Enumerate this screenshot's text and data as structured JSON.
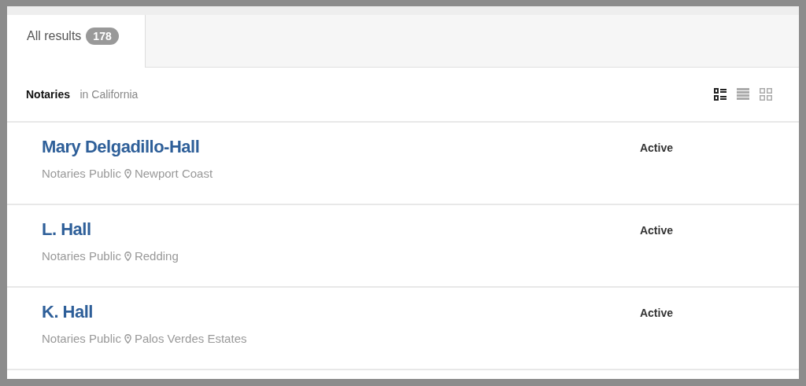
{
  "tabs": [
    {
      "label": "All results",
      "count": "178",
      "selected": true
    }
  ],
  "header": {
    "category": "Notaries",
    "location": "in California"
  },
  "view_options": [
    {
      "kind": "detail",
      "selected": true
    },
    {
      "kind": "list",
      "selected": false
    },
    {
      "kind": "grid",
      "selected": false
    }
  ],
  "results": [
    {
      "name": "Mary Delgadillo-Hall",
      "category": "Notaries Public",
      "place": "Newport Coast",
      "status": "Active"
    },
    {
      "name": "L. Hall",
      "category": "Notaries Public",
      "place": "Redding",
      "status": "Active"
    },
    {
      "name": "K. Hall",
      "category": "Notaries Public",
      "place": "Palos Verdes Estates",
      "status": "Active"
    }
  ]
}
